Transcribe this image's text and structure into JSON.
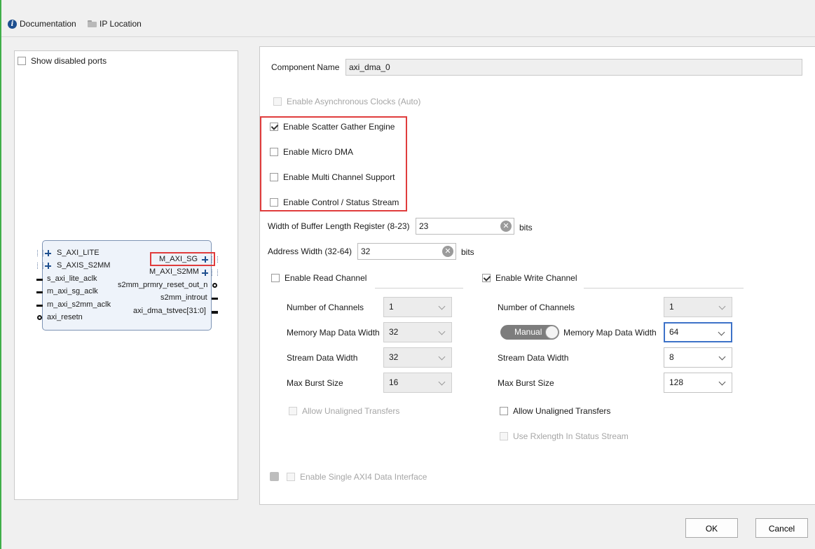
{
  "topbar": {
    "documentation": "Documentation",
    "ip_location": "IP Location"
  },
  "left_panel": {
    "show_disabled_ports": "Show disabled ports",
    "left_ports": [
      "S_AXI_LITE",
      "S_AXIS_S2MM",
      "s_axi_lite_aclk",
      "m_axi_sg_aclk",
      "m_axi_s2mm_aclk",
      "axi_resetn"
    ],
    "right_ports": [
      "M_AXI_SG",
      "M_AXI_S2MM",
      "s2mm_prmry_reset_out_n",
      "s2mm_introut",
      "axi_dma_tstvec[31:0]"
    ]
  },
  "component": {
    "label": "Component Name",
    "value": "axi_dma_0"
  },
  "options": {
    "async_clocks": "Enable Asynchronous Clocks (Auto)",
    "scatter_gather": "Enable Scatter Gather Engine",
    "micro_dma": "Enable Micro DMA",
    "multi_channel": "Enable Multi Channel Support",
    "control_status": "Enable Control / Status Stream"
  },
  "buffer_length": {
    "label": "Width of Buffer Length Register (8-23)",
    "value": "23",
    "unit": "bits"
  },
  "address_width": {
    "label": "Address Width (32-64)",
    "value": "32",
    "unit": "bits"
  },
  "read_channel": {
    "title": "Enable Read Channel",
    "num_channels_label": "Number of Channels",
    "num_channels": "1",
    "mm_width_label": "Memory Map Data Width",
    "mm_width": "32",
    "stream_width_label": "Stream Data Width",
    "stream_width": "32",
    "burst_label": "Max Burst Size",
    "burst": "16",
    "unaligned": "Allow Unaligned Transfers"
  },
  "write_channel": {
    "title": "Enable Write Channel",
    "num_channels_label": "Number of Channels",
    "num_channels": "1",
    "manual_toggle": "Manual",
    "mm_width_label": "Memory Map Data Width",
    "mm_width": "64",
    "stream_width_label": "Stream Data Width",
    "stream_width": "8",
    "burst_label": "Max Burst Size",
    "burst": "128",
    "unaligned": "Allow Unaligned Transfers",
    "rx_length": "Use Rxlength In Status Stream"
  },
  "single_axi4": "Enable Single AXI4 Data Interface",
  "buttons": {
    "ok": "OK",
    "cancel": "Cancel"
  },
  "colors": {
    "highlight": "#e03c3c",
    "focus": "#3d72c8",
    "block_fill": "#eef3fa"
  }
}
